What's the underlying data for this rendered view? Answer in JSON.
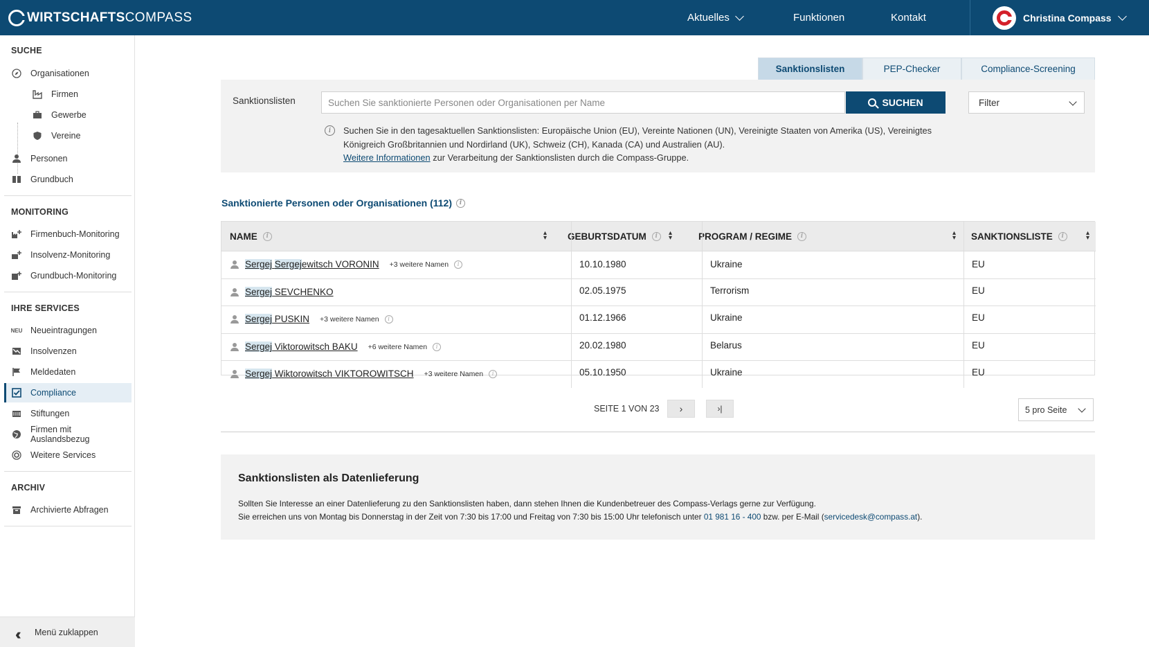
{
  "header": {
    "logo_bold": "WIRTSCHAFTS",
    "logo_light": "COMPASS",
    "nav": [
      "Aktuelles",
      "Funktionen",
      "Kontakt"
    ],
    "user_name": "Christina Compass"
  },
  "sidebar": {
    "sections": {
      "suche": "SUCHE",
      "monitoring": "MONITORING",
      "services": "IHRE SERVICES",
      "archiv": "ARCHIV"
    },
    "items": {
      "organisationen": "Organisationen",
      "firmen": "Firmen",
      "gewerbe": "Gewerbe",
      "vereine": "Vereine",
      "personen": "Personen",
      "grundbuch": "Grundbuch",
      "firmenbuch_monitoring": "Firmenbuch-Monitoring",
      "insolvenz_monitoring": "Insolvenz-Monitoring",
      "grundbuch_monitoring": "Grundbuch-Monitoring",
      "neueintragungen": "Neueintragungen",
      "neu_badge": "NEU",
      "insolvenzen": "Insolvenzen",
      "meldedaten": "Meldedaten",
      "compliance": "Compliance",
      "stiftungen": "Stiftungen",
      "auslandsbezug": "Firmen mit Auslandsbezug",
      "weitere_services": "Weitere Services",
      "archivierte_abfragen": "Archivierte Abfragen"
    },
    "collapse_label": "Menü zuklappen"
  },
  "tabs": [
    "Sanktionslisten",
    "PEP-Checker",
    "Compliance-Screening"
  ],
  "search": {
    "label": "Sanktionslisten",
    "placeholder": "Suchen Sie sanktionierte Personen oder Organisationen per Name",
    "button": "SUCHEN",
    "filter": "Filter",
    "info_line": "Suchen Sie in den tagesaktuellen Sanktionslisten: Europäische Union (EU), Vereinte Nationen (UN), Vereinigte Staaten von Amerika (US), Vereinigtes Königreich Großbritannien und Nordirland (UK), Schweiz (CH), Kanada (CA) und Australien (AU).",
    "info_link": "Weitere Informationen",
    "info_tail": "zur Verarbeitung der Sanktionslisten durch die Compass-Gruppe."
  },
  "results": {
    "heading": "Sanktionierte Personen oder Organisationen (112)",
    "columns": [
      "NAME",
      "GEBURTSDATUM",
      "PROGRAM / REGIME",
      "SANKTIONSLISTE"
    ],
    "rows": [
      {
        "name_hl": "Sergej",
        "name_hl2": "Sergej",
        "name_rest": "ewitsch VORONIN",
        "more": "+3 weitere Namen",
        "dob": "10.10.1980",
        "program": "Ukraine",
        "list": "EU"
      },
      {
        "name_hl": "Sergej",
        "name_rest": " SEVCHENKO",
        "more": "",
        "dob": "02.05.1975",
        "program": "Terrorism",
        "list": "EU"
      },
      {
        "name_hl": "Sergej",
        "name_rest": " PUSKIN",
        "more": "+3 weitere Namen",
        "dob": "01.12.1966",
        "program": "Ukraine",
        "list": "EU"
      },
      {
        "name_hl": "Sergej",
        "name_rest": " Viktorowitsch BAKU",
        "more": "+6 weitere Namen",
        "dob": "20.02.1980",
        "program": "Belarus",
        "list": "EU"
      },
      {
        "name_hl": "Sergej",
        "name_rest": " Wiktorowitsch VIKTOROWITSCH",
        "more": "+3 weitere Namen",
        "dob": "05.10.1950",
        "program": "Ukraine",
        "list": "EU"
      }
    ]
  },
  "pagination": {
    "text": "SEITE 1 VON 23",
    "per_page": "5 pro Seite"
  },
  "data_delivery": {
    "title": "Sanktionslisten als Datenlieferung",
    "line1": "Sollten Sie Interesse an einer Datenlieferung zu den Sanktionslisten haben, dann stehen Ihnen die Kundenbetreuer des Compass-Verlags gerne zur Verfügung.",
    "line2_a": "Sie erreichen uns von Montag bis Donnerstag in der Zeit von 7:30 bis 17:00 und Freitag von 7:30 bis 15:00 Uhr telefonisch unter",
    "phone": "01 981 16 - 400",
    "line2_b": "bzw. per E-Mail (",
    "email": "servicedesk@compass.at",
    "line2_c": ")."
  },
  "colors": {
    "primary": "#0d4a73",
    "accent_red": "#d4202a",
    "panel_bg": "#f2f2f2"
  }
}
